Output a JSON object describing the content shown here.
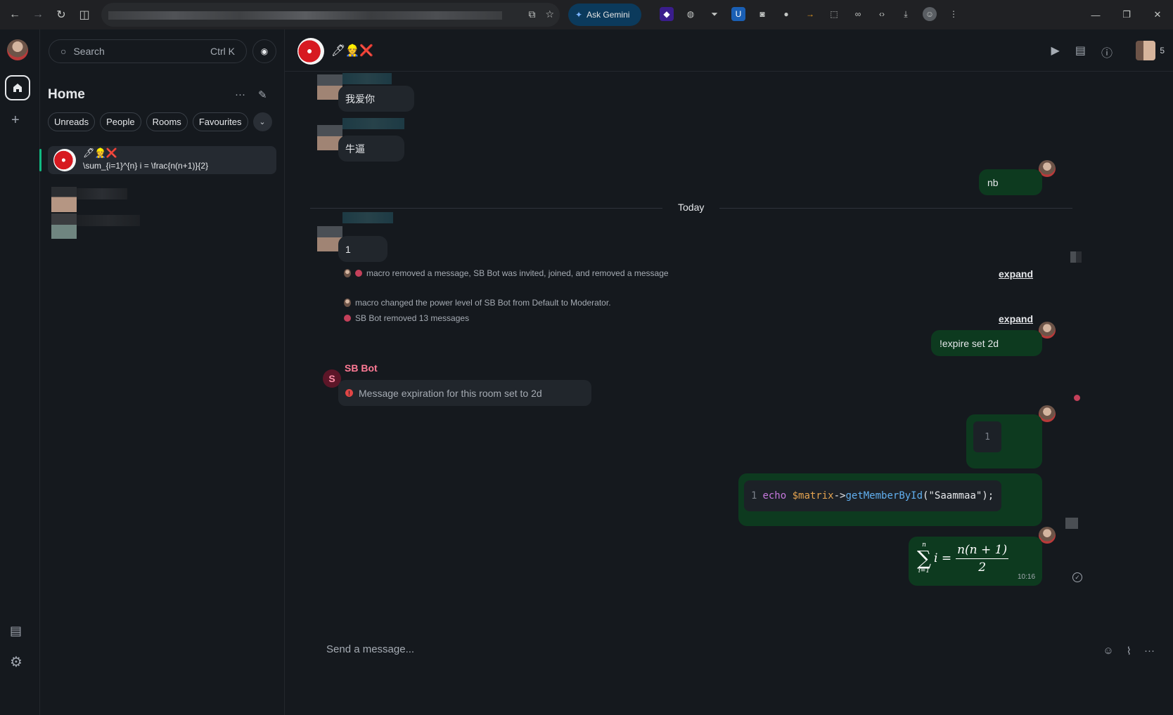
{
  "browser": {
    "ask_gemini": "Ask Gemini"
  },
  "sidebar": {
    "search_placeholder": "Search",
    "search_shortcut": "Ctrl K",
    "title": "Home",
    "filters": [
      "Unreads",
      "People",
      "Rooms",
      "Favourites"
    ],
    "active_room": {
      "name": "🖊👷❌",
      "last_message": "\\sum_{i=1}^{n} i = \\frac{n(n+1)}{2}"
    }
  },
  "room": {
    "name": "🖊👷❌",
    "member_count": "5"
  },
  "timeline": {
    "msg1": "我爱你",
    "msg2": "牛逼",
    "msg3_out": "nb",
    "date_divider": "Today",
    "msg4": "1",
    "event1": "macro removed a message, SB Bot was invited, joined, and removed a message",
    "event2": "macro changed the power level of SB Bot from Default to Moderator.",
    "event3": "SB Bot removed 13 messages",
    "expand_label": "expand",
    "out_expire": "!expire set 2d",
    "bot_name": "SB Bot",
    "bot_initial": "S",
    "bot_notice": "Message expiration for this room set to 2d",
    "inline_code_1": "1",
    "code_line_number": "1",
    "code_keyword": "echo ",
    "code_var": "$matrix",
    "code_arrow": "->",
    "code_fn": "getMemberById",
    "code_args": "(\"Saammaa\");",
    "math_sum_top": "n",
    "math_sum_bottom": "i=1",
    "math_var": "i =",
    "math_numerator": "n(n + 1)",
    "math_denominator": "2",
    "math_time": "10:16"
  },
  "composer": {
    "placeholder": "Send a message..."
  }
}
